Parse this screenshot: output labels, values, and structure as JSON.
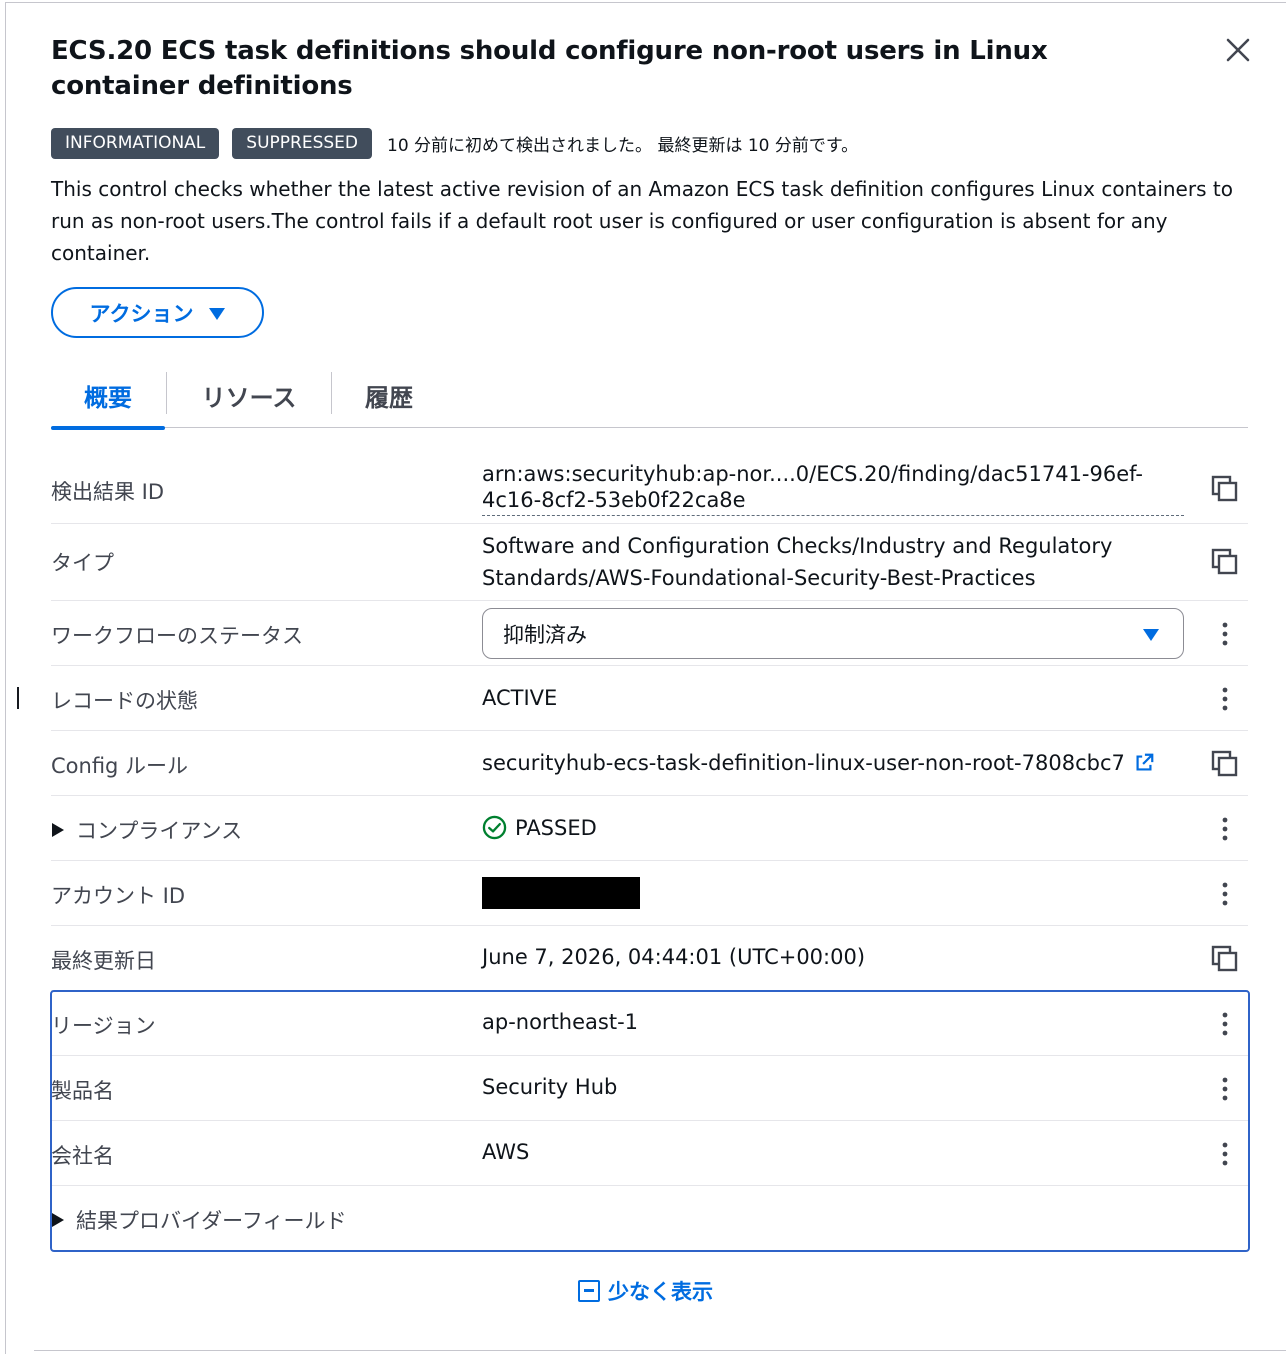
{
  "panel": {
    "title": "ECS.20 ECS task definitions should configure non-root users in Linux container definitions",
    "badges": [
      "INFORMATIONAL",
      "SUPPRESSED"
    ],
    "detected_text": "10 分前に初めて検出されました。 最終更新は 10 分前です。",
    "description": "This control checks whether the latest active revision of an Amazon ECS task definition configures Linux containers to run as non-root users.The control fails if a default root user is configured or user configuration is absent for any container.",
    "action_label": "アクション"
  },
  "tabs": [
    {
      "label": "概要",
      "active": true
    },
    {
      "label": "リソース",
      "active": false
    },
    {
      "label": "履歴",
      "active": false
    }
  ],
  "fields": {
    "finding_id": {
      "label": "検出結果 ID",
      "value": "arn:aws:securityhub:ap-nor....0/ECS.20/finding/dac51741-96ef-4c16-8cf2-53eb0f22ca8e"
    },
    "type": {
      "label": "タイプ",
      "value": "Software and Configuration Checks/Industry and Regulatory Standards/AWS-Foundational-Security-Best-Practices"
    },
    "workflow_status": {
      "label": "ワークフローのステータス",
      "value": "抑制済み"
    },
    "record_state": {
      "label": "レコードの状態",
      "value": "ACTIVE"
    },
    "config_rule": {
      "label": "Config ルール",
      "value": "securityhub-ecs-task-definition-linux-user-non-root-7808cbc7"
    },
    "compliance": {
      "label": "コンプライアンス",
      "value": "PASSED"
    },
    "account_id": {
      "label": "アカウント ID"
    },
    "last_updated": {
      "label": "最終更新日",
      "value": "June 7, 2026, 04:44:01 (UTC+00:00)"
    },
    "region": {
      "label": "リージョン",
      "value": "ap-northeast-1"
    },
    "product_name": {
      "label": "製品名",
      "value": "Security Hub"
    },
    "company_name": {
      "label": "会社名",
      "value": "AWS"
    },
    "provider_fields": {
      "label": "結果プロバイダーフィールド"
    }
  },
  "footer": {
    "show_less_label": "少なく表示"
  },
  "colors": {
    "accent": "#006ce0",
    "badge_bg": "#414d5c",
    "success": "#00802f",
    "highlight_border": "#2f63c8"
  }
}
